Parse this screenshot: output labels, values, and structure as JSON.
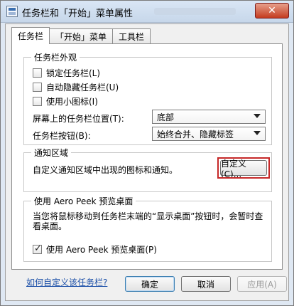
{
  "window": {
    "title": "任务栏和「开始」菜单属性",
    "close_label": "✕"
  },
  "tabs": [
    {
      "label": "任务栏"
    },
    {
      "label": "「开始」菜单"
    },
    {
      "label": "工具栏"
    }
  ],
  "taskbar_appearance": {
    "group_title": "任务栏外观",
    "options": [
      {
        "label": "锁定任务栏(L)",
        "checked": false
      },
      {
        "label": "自动隐藏任务栏(U)",
        "checked": false
      },
      {
        "label": "使用小图标(I)",
        "checked": false
      }
    ],
    "position_label": "屏幕上的任务栏位置(T):",
    "position_value": "底部",
    "buttons_label": "任务栏按钮(B):",
    "buttons_value": "始终合并、隐藏标签"
  },
  "notification_area": {
    "group_title": "通知区域",
    "description": "自定义通知区域中出现的图标和通知。",
    "customize_button": "自定义(C)..."
  },
  "aero_peek": {
    "group_title": "使用 Aero Peek 预览桌面",
    "description": "当您将鼠标移动到任务栏末端的“显示桌面”按钮时，会暂时查看桌面。",
    "checkbox_label": "使用 Aero Peek 预览桌面(P)",
    "checked": true
  },
  "help_link": "如何自定义该任务栏?",
  "buttons": {
    "ok": "确定",
    "cancel": "取消",
    "apply": "应用(A)"
  }
}
